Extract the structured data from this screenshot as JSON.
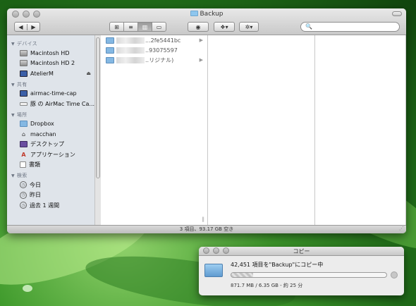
{
  "finder": {
    "title": "Backup",
    "nav": {
      "back": "◀",
      "forward": "▶"
    },
    "views": [
      "⊞",
      "≡",
      "▥",
      "▭"
    ],
    "toolbar": {
      "eye": "◉",
      "dropbox": "❖▾",
      "gear": "✲▾"
    },
    "search": {
      "icon": "🔍",
      "placeholder": "",
      "value": ""
    },
    "sidebar": {
      "sections": [
        {
          "label": "デバイス",
          "items": [
            {
              "label": "Macintosh HD",
              "icon": "hd"
            },
            {
              "label": "Macintosh HD 2",
              "icon": "hd"
            },
            {
              "label": "AtelierM",
              "icon": "mon",
              "eject": "⏏"
            }
          ]
        },
        {
          "label": "共有",
          "items": [
            {
              "label": "airmac-time-cap",
              "icon": "mon"
            },
            {
              "label": "豚 の AirMac Time Ca...",
              "icon": "nas"
            }
          ]
        },
        {
          "label": "場所",
          "items": [
            {
              "label": "Dropbox",
              "icon": "folder"
            },
            {
              "label": "macchan",
              "icon": "home"
            },
            {
              "label": "デスクトップ",
              "icon": "desk"
            },
            {
              "label": "アプリケーション",
              "icon": "app"
            },
            {
              "label": "書類",
              "icon": "doc"
            }
          ]
        },
        {
          "label": "検索",
          "items": [
            {
              "label": "今日",
              "icon": "clock"
            },
            {
              "label": "昨日",
              "icon": "clock"
            },
            {
              "label": "過去 1 週間",
              "icon": "clock"
            }
          ]
        }
      ]
    },
    "columns": {
      "col1": [
        {
          "name": "...2fe5441bc",
          "has_children": true
        },
        {
          "name": "..93075597",
          "has_children": false
        },
        {
          "name": "..リジナル)",
          "has_children": true
        }
      ]
    },
    "status": "3 項目、93.17 GB 空き"
  },
  "copy": {
    "title": "コピー",
    "message": "42,451 項目を\"Backup\"にコピー中",
    "progress_percent": 14,
    "details": "871.7 MB / 6.35 GB - 約 25 分"
  }
}
